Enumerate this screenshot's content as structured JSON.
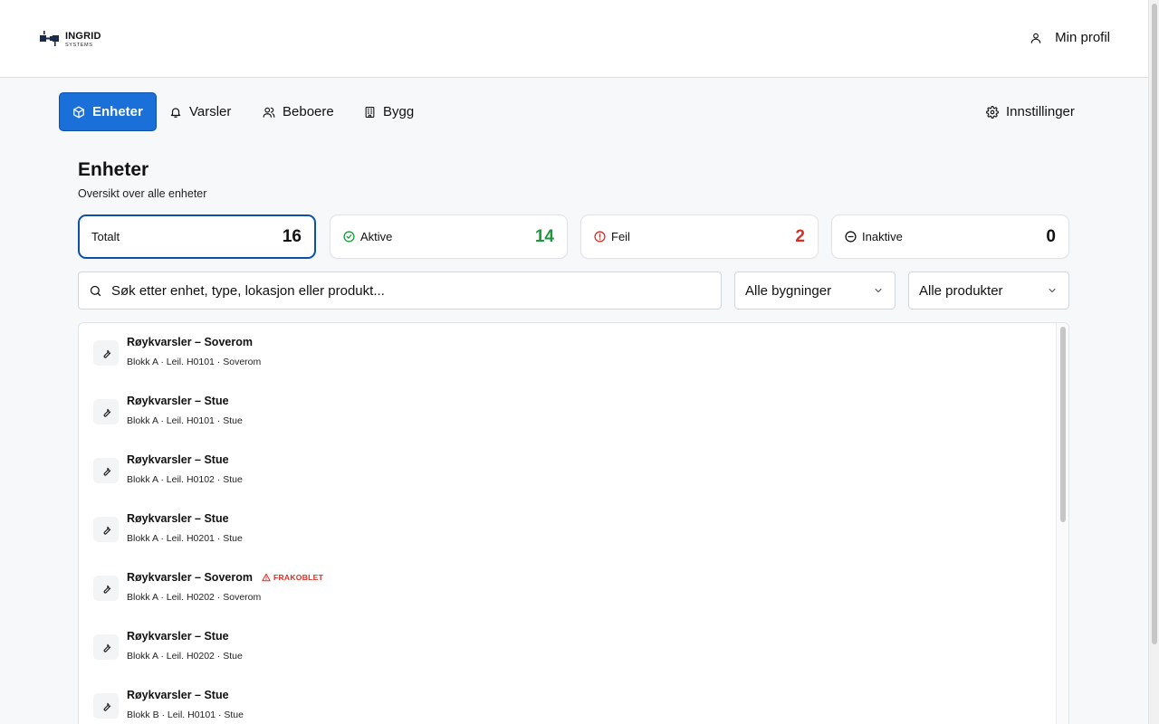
{
  "brand": {
    "name": "INGRID",
    "tagline": "SYSTEMS",
    "color": "#1b2a4a"
  },
  "header": {
    "profile_label": "Min profil"
  },
  "nav": {
    "items": [
      {
        "label": "Enheter",
        "icon": "cube-icon",
        "active": true
      },
      {
        "label": "Varsler",
        "icon": "bell-icon"
      },
      {
        "label": "Beboere",
        "icon": "users-icon"
      },
      {
        "label": "Bygg",
        "icon": "building-icon"
      }
    ],
    "settings_label": "Innstillinger",
    "accent": "#1a6fd8"
  },
  "page": {
    "title": "Enheter",
    "subtitle": "Oversikt over alle enheter"
  },
  "stats": {
    "total": {
      "label": "Totalt",
      "value": "16"
    },
    "active": {
      "label": "Aktive",
      "value": "14",
      "color": "#1a9a3a"
    },
    "error": {
      "label": "Feil",
      "value": "2",
      "color": "#d93025"
    },
    "inactive": {
      "label": "Inaktive",
      "value": "0"
    }
  },
  "filters": {
    "search_placeholder": "Søk etter enhet, type, lokasjon eller produkt...",
    "building_selected": "Alle bygninger",
    "product_selected": "Alle produkter"
  },
  "units": [
    {
      "title": "Røykvarsler – Soverom",
      "subtitle": "Blokk A · Leil. H0101 · Soverom",
      "badge": ""
    },
    {
      "title": "Røykvarsler – Stue",
      "subtitle": "Blokk A · Leil. H0101 · Stue",
      "badge": ""
    },
    {
      "title": "Røykvarsler – Stue",
      "subtitle": "Blokk A · Leil. H0102 · Stue",
      "badge": ""
    },
    {
      "title": "Røykvarsler – Stue",
      "subtitle": "Blokk A · Leil. H0201 · Stue",
      "badge": ""
    },
    {
      "title": "Røykvarsler – Soverom",
      "subtitle": "Blokk A · Leil. H0202 · Soverom",
      "badge": "FRAKOBLET"
    },
    {
      "title": "Røykvarsler – Stue",
      "subtitle": "Blokk A · Leil. H0202 · Stue",
      "badge": ""
    },
    {
      "title": "Røykvarsler – Stue",
      "subtitle": "Blokk B · Leil. H0101 · Stue",
      "badge": ""
    }
  ]
}
